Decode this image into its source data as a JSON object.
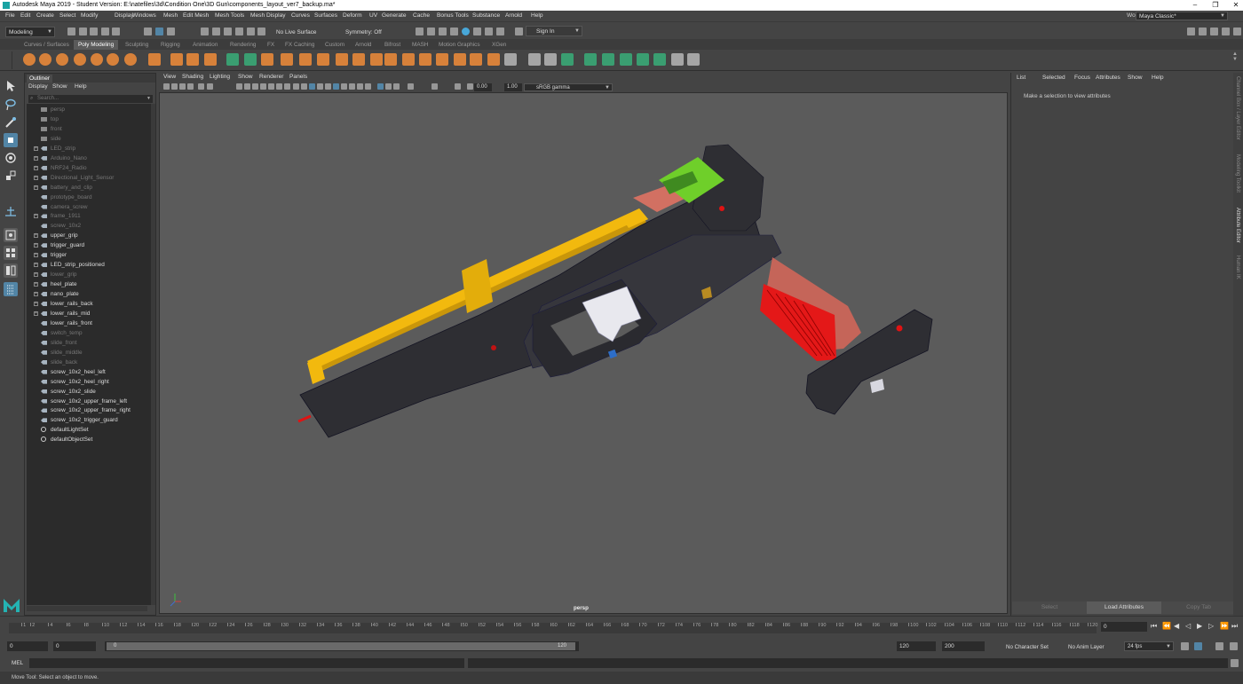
{
  "window": {
    "title": "Autodesk Maya 2019 - Student Version: E:\\natefiles\\3d\\Condition One\\3D Gun\\components_layout_ver7_backup.ma*",
    "minimize": "–",
    "maximize": "❐",
    "close": "✕"
  },
  "menubar": {
    "items": [
      "File",
      "Edit",
      "Create",
      "Select",
      "Modify",
      "Display",
      "Windows",
      "Mesh",
      "Edit Mesh",
      "Mesh Tools",
      "Mesh Display",
      "Curves",
      "Surfaces",
      "Deform",
      "UV",
      "Generate",
      "Cache",
      "Bonus Tools",
      "Substance",
      "Arnold",
      "Help"
    ],
    "workspace_label": "Workspace :",
    "workspace_value": "Maya Classic*"
  },
  "statusline": {
    "mode": "Modeling",
    "live_surface": "No Live Surface",
    "symmetry": "Symmetry: Off",
    "sign_in": "Sign In"
  },
  "shelf": {
    "tabs": [
      "Curves / Surfaces",
      "Poly Modeling",
      "Sculpting",
      "Rigging",
      "Animation",
      "Rendering",
      "FX",
      "FX Caching",
      "Custom",
      "Arnold",
      "Bifrost",
      "MASH",
      "Motion Graphics",
      "XGen"
    ],
    "active_tab": "Poly Modeling"
  },
  "outliner": {
    "tab": "Outliner",
    "menu": [
      "Display",
      "Show",
      "Help"
    ],
    "search_placeholder": "Search...",
    "items": [
      {
        "label": "persp",
        "dim": true,
        "exp": false,
        "icon": "camera"
      },
      {
        "label": "top",
        "dim": true,
        "exp": false,
        "icon": "camera"
      },
      {
        "label": "front",
        "dim": true,
        "exp": false,
        "icon": "camera"
      },
      {
        "label": "side",
        "dim": true,
        "exp": false,
        "icon": "camera"
      },
      {
        "label": "LED_strip",
        "dim": true,
        "exp": true,
        "icon": "group"
      },
      {
        "label": "Arduino_Nano",
        "dim": true,
        "exp": true,
        "icon": "group"
      },
      {
        "label": "NRF24_Radio",
        "dim": true,
        "exp": true,
        "icon": "group"
      },
      {
        "label": "Directional_Light_Sensor",
        "dim": true,
        "exp": true,
        "icon": "group"
      },
      {
        "label": "battery_and_clip",
        "dim": true,
        "exp": true,
        "icon": "group"
      },
      {
        "label": "prototype_board",
        "dim": true,
        "exp": false,
        "icon": "group"
      },
      {
        "label": "camera_screw",
        "dim": true,
        "exp": false,
        "icon": "group"
      },
      {
        "label": "frame_1911",
        "dim": true,
        "exp": true,
        "icon": "group"
      },
      {
        "label": "screw_10x2",
        "dim": true,
        "exp": false,
        "icon": "group"
      },
      {
        "label": "upper_grip",
        "dim": false,
        "exp": true,
        "icon": "group"
      },
      {
        "label": "trigger_guard",
        "dim": false,
        "exp": true,
        "icon": "group"
      },
      {
        "label": "trigger",
        "dim": false,
        "exp": true,
        "icon": "group"
      },
      {
        "label": "LED_strip_positioned",
        "dim": false,
        "exp": true,
        "icon": "group"
      },
      {
        "label": "lower_grip",
        "dim": true,
        "exp": true,
        "icon": "group"
      },
      {
        "label": "heel_plate",
        "dim": false,
        "exp": true,
        "icon": "group"
      },
      {
        "label": "nano_plate",
        "dim": false,
        "exp": true,
        "icon": "group"
      },
      {
        "label": "lower_rails_back",
        "dim": false,
        "exp": true,
        "icon": "group"
      },
      {
        "label": "lower_rails_mid",
        "dim": false,
        "exp": true,
        "icon": "group"
      },
      {
        "label": "lower_rails_front",
        "dim": false,
        "exp": false,
        "icon": "group"
      },
      {
        "label": "switch_temp",
        "dim": true,
        "exp": false,
        "icon": "group"
      },
      {
        "label": "slide_front",
        "dim": true,
        "exp": false,
        "icon": "group"
      },
      {
        "label": "slide_middle",
        "dim": true,
        "exp": false,
        "icon": "group"
      },
      {
        "label": "slide_back",
        "dim": true,
        "exp": false,
        "icon": "group"
      },
      {
        "label": "screw_10x2_heel_left",
        "dim": false,
        "exp": false,
        "icon": "group"
      },
      {
        "label": "screw_10x2_heel_right",
        "dim": false,
        "exp": false,
        "icon": "group"
      },
      {
        "label": "screw_10x2_slide",
        "dim": false,
        "exp": false,
        "icon": "group"
      },
      {
        "label": "screw_10x2_upper_frame_left",
        "dim": false,
        "exp": false,
        "icon": "group"
      },
      {
        "label": "screw_10x2_upper_frame_right",
        "dim": false,
        "exp": false,
        "icon": "group"
      },
      {
        "label": "screw_10x2_trigger_guard",
        "dim": false,
        "exp": false,
        "icon": "group"
      },
      {
        "label": "defaultLightSet",
        "dim": false,
        "exp": false,
        "icon": "set"
      },
      {
        "label": "defaultObjectSet",
        "dim": false,
        "exp": false,
        "icon": "set"
      }
    ]
  },
  "viewport": {
    "menu": [
      "View",
      "Shading",
      "Lighting",
      "Show",
      "Renderer",
      "Panels"
    ],
    "exposure": "0.00",
    "gamma": "1.00",
    "color_space": "sRGB gamma",
    "camera_label": "persp"
  },
  "attribute_editor": {
    "menu": [
      "List",
      "Selected",
      "Focus",
      "Attributes",
      "Show",
      "Help"
    ],
    "message": "Make a selection to view attributes",
    "buttons": [
      "Select",
      "Load Attributes",
      "Copy Tab"
    ]
  },
  "side_tabs": [
    "Channel Box / Layer Editor",
    "Modeling Toolkit",
    "Attribute Editor",
    "Human IK"
  ],
  "timeline": {
    "ticks": [
      1,
      2,
      4,
      6,
      8,
      10,
      12,
      14,
      16,
      18,
      20,
      22,
      24,
      26,
      28,
      30,
      32,
      34,
      36,
      38,
      40,
      42,
      44,
      46,
      48,
      50,
      52,
      54,
      56,
      58,
      60,
      62,
      64,
      66,
      68,
      70,
      72,
      74,
      76,
      78,
      80,
      82,
      84,
      86,
      88,
      90,
      92,
      94,
      96,
      98,
      100,
      102,
      104,
      106,
      108,
      110,
      112,
      114,
      116,
      118,
      120
    ],
    "current_frame": "0"
  },
  "range": {
    "start": "0",
    "anim_start": "0",
    "slider_start": "0",
    "slider_end": "120",
    "end": "120",
    "anim_end": "200",
    "character_set": "No Character Set",
    "anim_layer": "No Anim Layer",
    "fps": "24 fps"
  },
  "command": {
    "lang": "MEL"
  },
  "helpline": {
    "text": "Move Tool: Select an object to move."
  },
  "colors": {
    "select_blue": "#5285a6",
    "shelf_orange": "#e8883a",
    "shelf_green": "#3aa877",
    "gun_dark": "#2e2e33",
    "slide_yellow": "#f2b90e",
    "led_red": "#e01313"
  }
}
